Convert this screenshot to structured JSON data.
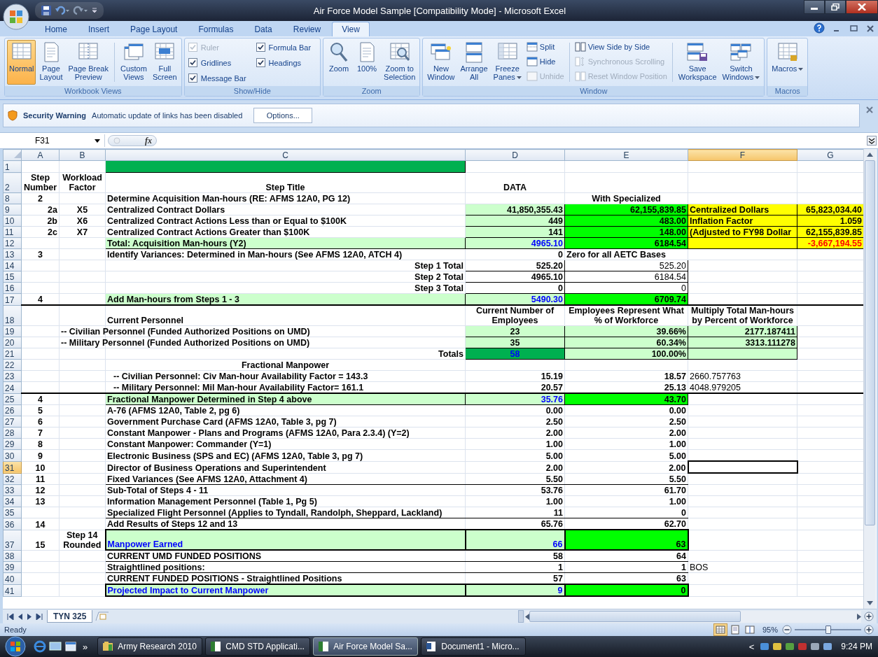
{
  "window": {
    "title": "Air Force Model Sample  [Compatibility Mode] - Microsoft Excel"
  },
  "ribbon_tabs": [
    {
      "label": "Home",
      "selected": false
    },
    {
      "label": "Insert",
      "selected": false
    },
    {
      "label": "Page Layout",
      "selected": false
    },
    {
      "label": "Formulas",
      "selected": false
    },
    {
      "label": "Data",
      "selected": false
    },
    {
      "label": "Review",
      "selected": false
    },
    {
      "label": "View",
      "selected": true
    }
  ],
  "ribbon_groups": [
    {
      "title": "Workbook Views",
      "items": [
        {
          "kind": "large",
          "label": "Normal",
          "selected": true
        },
        {
          "kind": "large",
          "label": "Page\nLayout",
          "selected": false
        },
        {
          "kind": "large",
          "label": "Page Break\nPreview",
          "selected": false
        },
        {
          "kind": "separator"
        },
        {
          "kind": "large",
          "label": "Custom\nViews",
          "selected": false
        },
        {
          "kind": "large",
          "label": "Full\nScreen",
          "selected": false
        }
      ]
    },
    {
      "title": "Show/Hide",
      "items": [
        {
          "kind": "stack",
          "items": [
            {
              "kind": "check",
              "label": "Ruler",
              "checked": true,
              "disabled": true
            },
            {
              "kind": "check",
              "label": "Gridlines",
              "checked": true,
              "disabled": false
            },
            {
              "kind": "check",
              "label": "Message Bar",
              "checked": true,
              "disabled": false
            }
          ]
        },
        {
          "kind": "stack",
          "items": [
            {
              "kind": "check",
              "label": "Formula Bar",
              "checked": true,
              "disabled": false
            },
            {
              "kind": "check",
              "label": "Headings",
              "checked": true,
              "disabled": false
            }
          ]
        }
      ]
    },
    {
      "title": "Zoom",
      "items": [
        {
          "kind": "large",
          "label": "Zoom"
        },
        {
          "kind": "large",
          "label": "100%"
        },
        {
          "kind": "large",
          "label": "Zoom to\nSelection"
        }
      ]
    },
    {
      "title": "Window",
      "items": [
        {
          "kind": "large",
          "label": "New\nWindow"
        },
        {
          "kind": "large",
          "label": "Arrange\nAll"
        },
        {
          "kind": "large",
          "label": "Freeze\nPanes",
          "dropdown": true
        },
        {
          "kind": "stack",
          "items": [
            {
              "kind": "small",
              "label": "Split",
              "disabled": false
            },
            {
              "kind": "small",
              "label": "Hide",
              "disabled": false
            },
            {
              "kind": "small",
              "label": "Unhide",
              "disabled": true
            }
          ]
        },
        {
          "kind": "separator"
        },
        {
          "kind": "stack",
          "items": [
            {
              "kind": "small",
              "label": "View Side by Side",
              "disabled": false
            },
            {
              "kind": "small",
              "label": "Synchronous Scrolling",
              "disabled": true
            },
            {
              "kind": "small",
              "label": "Reset Window Position",
              "disabled": true
            }
          ]
        },
        {
          "kind": "separator"
        },
        {
          "kind": "large",
          "label": "Save\nWorkspace"
        },
        {
          "kind": "large",
          "label": "Switch\nWindows",
          "dropdown": true
        }
      ]
    },
    {
      "title": "Macros",
      "items": [
        {
          "kind": "large",
          "label": "Macros",
          "dropdown": true
        }
      ]
    }
  ],
  "message_bar": {
    "title": "Security Warning",
    "text": "Automatic update of links has been disabled",
    "button": "Options..."
  },
  "formula_bar": {
    "name_box": "F31",
    "function_label": "fx"
  },
  "sheet": {
    "columns": [
      {
        "label": "A",
        "selected": false
      },
      {
        "label": "B",
        "selected": false
      },
      {
        "label": "C",
        "selected": false
      },
      {
        "label": "D",
        "selected": false
      },
      {
        "label": "E",
        "selected": false
      },
      {
        "label": "F",
        "selected": true
      },
      {
        "label": "G",
        "selected": false
      }
    ],
    "rows": [
      {
        "label": "1",
        "selected": false,
        "C": {
          "color": "#00b050"
        }
      },
      {
        "label": "2",
        "selected": false,
        "A": {
          "text": "Step Number",
          "kind": "heading"
        },
        "B": {
          "text": "Workload Factor",
          "kind": "heading"
        },
        "C": {
          "text": "Step Title",
          "kind": "heading"
        },
        "D": {
          "text": "DATA",
          "kind": "heading"
        }
      },
      {
        "label": "8",
        "selected": false,
        "A": {
          "text": "2",
          "kind": "heading"
        },
        "C": {
          "text": "Determine Acquisition Man-hours (RE:  AFMS 12A0, PG 12)",
          "kind": "label"
        },
        "E": {
          "text": "With Specialized",
          "kind": "heading"
        }
      },
      {
        "label": "9",
        "selected": false,
        "A": {
          "text": "2a",
          "kind": "number"
        },
        "B": {
          "text": "X5",
          "kind": "heading"
        },
        "C": {
          "text": "Centralized Contract Dollars",
          "kind": "label"
        },
        "D": {
          "text": "41,850,355.43",
          "kind": "number",
          "color": "#ccffcc"
        },
        "E": {
          "text": "62,155,839.85",
          "kind": "number",
          "color": "#00ff00"
        },
        "F": {
          "text": "Centralized Dollars",
          "kind": "label",
          "color": "#ffff00"
        },
        "G": {
          "text": "65,823,034.40",
          "kind": "number",
          "color": "#ffff00"
        }
      },
      {
        "label": "10",
        "selected": false,
        "A": {
          "text": "2b",
          "kind": "number"
        },
        "B": {
          "text": "X6",
          "kind": "heading"
        },
        "C": {
          "text": "Centralized Contract Actions Less than or Equal to $100K",
          "kind": "label"
        },
        "D": {
          "text": "449",
          "kind": "number",
          "color": "#ccffcc"
        },
        "E": {
          "text": "483.00",
          "kind": "number",
          "color": "#00ff00"
        },
        "F": {
          "text": "Inflation Factor",
          "kind": "label",
          "color": "#ffff00"
        },
        "G": {
          "text": "1.059",
          "kind": "number",
          "color": "#ffff00"
        }
      },
      {
        "label": "11",
        "selected": false,
        "A": {
          "text": "2c",
          "kind": "number"
        },
        "B": {
          "text": "X7",
          "kind": "heading"
        },
        "C": {
          "text": "Centralized Contract Actions Greater than $100K",
          "kind": "label"
        },
        "D": {
          "text": "141",
          "kind": "number",
          "color": "#ccffcc"
        },
        "E": {
          "text": "148.00",
          "kind": "number",
          "color": "#00ff00"
        },
        "F": {
          "text": "(Adjusted to FY98 Dollar",
          "kind": "label",
          "color": "#ffff00"
        },
        "G": {
          "text": "62,155,839.85",
          "kind": "number",
          "color": "#ffff00"
        }
      },
      {
        "label": "12",
        "selected": false,
        "C": {
          "text": "Total:  Acquisition Man-hours (Y2)",
          "kind": "label",
          "color": "#ccffcc"
        },
        "D": {
          "text": "4965.10",
          "kind": "number",
          "color": "#ccffcc",
          "ink": {
            "color": "#0000ff"
          }
        },
        "E": {
          "text": "6184.54",
          "kind": "number",
          "color": "#00ff00"
        },
        "F": {
          "color": "#ffff00"
        },
        "G": {
          "text": "-3,667,194.55",
          "kind": "number",
          "color": "#ffff00",
          "ink": {
            "color": "#ff0000"
          }
        }
      },
      {
        "label": "13",
        "selected": false,
        "A": {
          "text": "3",
          "kind": "heading"
        },
        "C": {
          "text": "Identify Variances:  Determined in Man-hours (See AFMS 12A0, ATCH 4)",
          "kind": "label"
        },
        "D": {
          "text": "0",
          "kind": "number"
        },
        "E": {
          "text": "Zero for all AETC Bases",
          "kind": "label"
        }
      },
      {
        "label": "14",
        "selected": false,
        "C": {
          "text": "Step 1 Total",
          "kind": "number"
        },
        "D": {
          "text": "525.20",
          "kind": "number",
          "boxed": true
        },
        "E": {
          "text": "525.20",
          "kind": "value",
          "boxed": true
        }
      },
      {
        "label": "15",
        "selected": false,
        "C": {
          "text": "Step 2 Total",
          "kind": "number"
        },
        "D": {
          "text": "4965.10",
          "kind": "number",
          "boxed": true
        },
        "E": {
          "text": "6184.54",
          "kind": "value",
          "boxed": true
        }
      },
      {
        "label": "16",
        "selected": false,
        "C": {
          "text": "Step 3 Total",
          "kind": "number"
        },
        "D": {
          "text": "0",
          "kind": "number",
          "boxed": true
        },
        "E": {
          "text": "0",
          "kind": "value",
          "boxed": true
        }
      },
      {
        "label": "17",
        "selected": false,
        "rule_below": true,
        "A": {
          "text": "4",
          "kind": "heading"
        },
        "C": {
          "text": "Add Man-hours from Steps 1 - 3",
          "kind": "label",
          "color": "#ccffcc"
        },
        "D": {
          "text": "5490.30",
          "kind": "number",
          "color": "#ccffcc",
          "ink": {
            "color": "#0000ff"
          }
        },
        "E": {
          "text": "6709.74",
          "kind": "number",
          "color": "#00ff00"
        }
      },
      {
        "label": "18",
        "selected": false,
        "C": {
          "text": "Current Personnel",
          "kind": "label"
        },
        "D": {
          "text": "Current Number of Employees",
          "kind": "heading"
        },
        "E": {
          "text": "Employees Represent What % of Workforce",
          "kind": "heading"
        },
        "F": {
          "text": "Multiply Total Man-hours by Percent of Workforce",
          "kind": "heading"
        }
      },
      {
        "label": "19",
        "selected": false,
        "B": {
          "text": "-- Civilian Personnel  (Funded Authorized Positions on UMD)",
          "kind": "label"
        },
        "D": {
          "text": "23",
          "kind": "heading",
          "color": "#ccffcc"
        },
        "E": {
          "text": "39.66%",
          "kind": "number",
          "color": "#ccffcc"
        },
        "F": {
          "text": "2177.187411",
          "kind": "number",
          "color": "#ccffcc"
        }
      },
      {
        "label": "20",
        "selected": false,
        "B": {
          "text": "-- Military Personnel  (Funded Authorized Positions on UMD)",
          "kind": "label"
        },
        "D": {
          "text": "35",
          "kind": "heading",
          "color": "#ccffcc"
        },
        "E": {
          "text": "60.34%",
          "kind": "number",
          "color": "#ccffcc"
        },
        "F": {
          "text": "3313.111278",
          "kind": "number",
          "color": "#ccffcc"
        }
      },
      {
        "label": "21",
        "selected": false,
        "C": {
          "text": "Totals",
          "kind": "number"
        },
        "D": {
          "text": "58",
          "kind": "heading",
          "color": "#00b050",
          "ink": {
            "color": "#0000ff"
          }
        },
        "E": {
          "text": "100.00%",
          "kind": "number",
          "color": "#ccffcc"
        },
        "F": {
          "color": "#ccffcc"
        }
      },
      {
        "label": "22",
        "selected": false,
        "C": {
          "text": "Fractional Manpower",
          "kind": "heading"
        }
      },
      {
        "label": "23",
        "selected": false,
        "C": {
          "text": "-- Civilian Personnel:  Civ Man-hour Availability Factor = 143.3",
          "kind": "indented"
        },
        "D": {
          "text": "15.19",
          "kind": "number"
        },
        "E": {
          "text": "18.57",
          "kind": "number"
        },
        "F": {
          "text": "2660.757763",
          "kind": "note"
        }
      },
      {
        "label": "24",
        "selected": false,
        "rule_below": true,
        "C": {
          "text": "-- Military Personnel:  Mil Man-hour Availability Factor= 161.1",
          "kind": "indented"
        },
        "D": {
          "text": "20.57",
          "kind": "number"
        },
        "E": {
          "text": "25.13",
          "kind": "number"
        },
        "F": {
          "text": "4048.979205",
          "kind": "note"
        }
      },
      {
        "label": "25",
        "selected": false,
        "A": {
          "text": "4",
          "kind": "heading"
        },
        "C": {
          "text": "Fractional Manpower Determined in Step 4 above",
          "kind": "label",
          "color": "#ccffcc"
        },
        "D": {
          "text": "35.76",
          "kind": "number",
          "color": "#ccffcc",
          "ink": {
            "color": "#0000ff"
          }
        },
        "E": {
          "text": "43.70",
          "kind": "number",
          "color": "#00ff00"
        }
      },
      {
        "label": "26",
        "selected": false,
        "A": {
          "text": "5",
          "kind": "heading"
        },
        "C": {
          "text": "A-76 (AFMS 12A0, Table 2, pg 6)",
          "kind": "label"
        },
        "D": {
          "text": "0.00",
          "kind": "number"
        },
        "E": {
          "text": "0.00",
          "kind": "number"
        }
      },
      {
        "label": "27",
        "selected": false,
        "A": {
          "text": "6",
          "kind": "heading"
        },
        "C": {
          "text": "Government Purchase Card (AFMS 12A0, Table 3, pg 7)",
          "kind": "label"
        },
        "D": {
          "text": "2.50",
          "kind": "number"
        },
        "E": {
          "text": "2.50",
          "kind": "number"
        }
      },
      {
        "label": "28",
        "selected": false,
        "A": {
          "text": "7",
          "kind": "heading"
        },
        "C": {
          "text": "Constant Manpower - Plans and Programs (AFMS 12A0, Para 2.3.4)  (Y=2)",
          "kind": "label"
        },
        "D": {
          "text": "2.00",
          "kind": "number"
        },
        "E": {
          "text": "2.00",
          "kind": "number"
        }
      },
      {
        "label": "29",
        "selected": false,
        "A": {
          "text": "8",
          "kind": "heading"
        },
        "C": {
          "text": "Constant Manpower:  Commander (Y=1)",
          "kind": "label"
        },
        "D": {
          "text": "1.00",
          "kind": "number"
        },
        "E": {
          "text": "1.00",
          "kind": "number"
        }
      },
      {
        "label": "30",
        "selected": false,
        "A": {
          "text": "9",
          "kind": "heading"
        },
        "C": {
          "text": "Electronic Business (SPS and EC) (AFMS 12A0, Table 3, pg 7)",
          "kind": "label"
        },
        "D": {
          "text": "5.00",
          "kind": "number"
        },
        "E": {
          "text": "5.00",
          "kind": "number"
        }
      },
      {
        "label": "31",
        "selected": true,
        "A": {
          "text": "10",
          "kind": "heading"
        },
        "C": {
          "text": "Director of Business Operations and Superintendent",
          "kind": "label"
        },
        "D": {
          "text": "2.00",
          "kind": "number"
        },
        "E": {
          "text": "2.00",
          "kind": "number"
        }
      },
      {
        "label": "32",
        "selected": false,
        "underlined": true,
        "A": {
          "text": "11",
          "kind": "heading"
        },
        "C": {
          "text": "Fixed Variances (See AFMS 12A0, Attachment 4)",
          "kind": "label"
        },
        "D": {
          "text": "5.50",
          "kind": "number"
        },
        "E": {
          "text": "5.50",
          "kind": "number"
        }
      },
      {
        "label": "33",
        "selected": false,
        "A": {
          "text": "12",
          "kind": "heading"
        },
        "C": {
          "text": "Sub-Total of Steps 4 - 11",
          "kind": "label"
        },
        "D": {
          "text": "53.76",
          "kind": "number"
        },
        "E": {
          "text": "61.70",
          "kind": "number"
        }
      },
      {
        "label": "34",
        "selected": false,
        "A": {
          "text": "13",
          "kind": "heading"
        },
        "C": {
          "text": "Information Management Personnel (Table 1, Pg 5)",
          "kind": "label"
        },
        "D": {
          "text": "1.00",
          "kind": "number"
        },
        "E": {
          "text": "1.00",
          "kind": "number"
        }
      },
      {
        "label": "35",
        "selected": false,
        "underlined": true,
        "C": {
          "text": "Specialized Flight Personnel  (Applies to Tyndall, Randolph, Sheppard, Lackland)",
          "kind": "label"
        },
        "D": {
          "text": "11",
          "kind": "number"
        },
        "E": {
          "text": "0",
          "kind": "number"
        }
      },
      {
        "label": "36",
        "selected": false,
        "A": {
          "text": "14",
          "kind": "heading"
        },
        "C": {
          "text": "Add Results of Steps 12 and 13",
          "kind": "label"
        },
        "D": {
          "text": "65.76",
          "kind": "number"
        },
        "E": {
          "text": "62.70",
          "kind": "number"
        }
      },
      {
        "label": "37",
        "selected": false,
        "A": {
          "text": "15",
          "kind": "heading"
        },
        "B": {
          "text": "Step 14 Rounded",
          "kind": "heading"
        },
        "C": {
          "text": "Manpower Earned",
          "kind": "label",
          "color": "#ccffcc",
          "thick": true,
          "ink": {
            "color": "#0000ff"
          }
        },
        "D": {
          "text": "66",
          "kind": "number",
          "color": "#ccffcc",
          "thick": true,
          "ink": {
            "color": "#0000ff"
          }
        },
        "E": {
          "text": "63",
          "kind": "number",
          "color": "#00ff00",
          "thick": true
        }
      },
      {
        "label": "38",
        "selected": false,
        "underlined": true,
        "C": {
          "text": "CURRENT UMD FUNDED POSITIONS",
          "kind": "label"
        },
        "D": {
          "text": "58",
          "kind": "number"
        },
        "E": {
          "text": "64",
          "kind": "number"
        }
      },
      {
        "label": "39",
        "selected": false,
        "underlined": true,
        "C": {
          "text": "Straightlined positions:",
          "kind": "label"
        },
        "D": {
          "text": "1",
          "kind": "number"
        },
        "E": {
          "text": "1",
          "kind": "number"
        },
        "F": {
          "text": "BOS",
          "kind": "note"
        }
      },
      {
        "label": "40",
        "selected": false,
        "C": {
          "text": "CURRENT FUNDED POSITIONS - Straightlined Positions",
          "kind": "label"
        },
        "D": {
          "text": "57",
          "kind": "number"
        },
        "E": {
          "text": "63",
          "kind": "number"
        }
      },
      {
        "label": "41",
        "selected": false,
        "C": {
          "text": "Projected Impact to Current Manpower",
          "kind": "label",
          "color": "#ccffcc",
          "thick": true,
          "ink": {
            "color": "#0000ff"
          }
        },
        "D": {
          "text": "9",
          "kind": "number",
          "color": "#ccffcc",
          "thick": true,
          "ink": {
            "color": "#0000ff"
          }
        },
        "E": {
          "text": "0",
          "kind": "number",
          "color": "#00ff00",
          "thick": true
        }
      }
    ]
  },
  "sheet_tabs": [
    {
      "label": "TYN 325",
      "selected": true
    }
  ],
  "status_bar": {
    "status": "Ready",
    "view_buttons": [
      {
        "selected": true
      },
      {
        "selected": false
      },
      {
        "selected": false
      }
    ],
    "zoom": "95%",
    "zoom_slider": {
      "level": 0.5
    }
  },
  "taskbar": {
    "overflow": "»",
    "tasks": [
      {
        "label": "Army Research 2010",
        "selected": false
      },
      {
        "label": "CMD STD Applicati...",
        "selected": false
      },
      {
        "label": "Air Force Model Sa...",
        "selected": true
      },
      {
        "label": "Document1 - Micro...",
        "selected": false
      }
    ],
    "tray_toggle": "<",
    "clock": "9:24 PM"
  }
}
